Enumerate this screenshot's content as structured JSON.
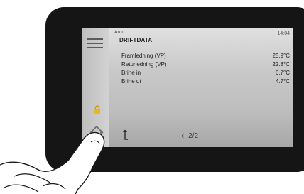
{
  "header": {
    "mode": "Auto",
    "title": "DRIFTDATA",
    "time": "14:04"
  },
  "rows": [
    {
      "label": "Framledning (VP)",
      "value": "25.9°C"
    },
    {
      "label": "Returledning (VP)",
      "value": "22.8°C"
    },
    {
      "label": "Brine in",
      "value": "6.7°C"
    },
    {
      "label": "Brine ut",
      "value": "4.7°C"
    }
  ],
  "pager": {
    "text": "2/2"
  },
  "icons": {
    "menu": "hamburger-menu-icon",
    "lock": "lock-icon",
    "home": "home-icon",
    "up": "up-arrow-icon",
    "back": "chevron-left-icon"
  },
  "colors": {
    "lock": "#e8b61e",
    "bezel": "#151515"
  }
}
